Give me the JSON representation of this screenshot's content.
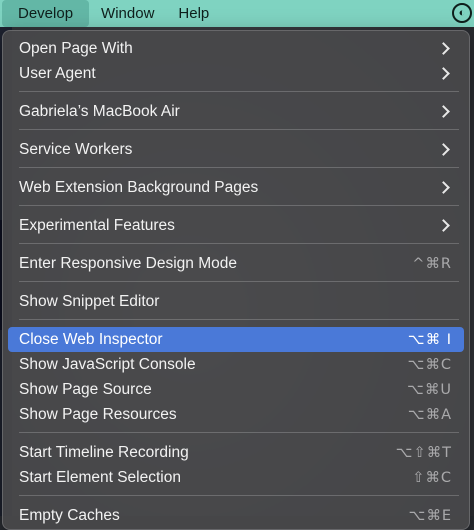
{
  "menubar": {
    "items": [
      {
        "label": "Develop",
        "active": true
      },
      {
        "label": "Window",
        "active": false
      },
      {
        "label": "Help",
        "active": false
      }
    ],
    "status_icon": "status-circle-icon"
  },
  "menu": {
    "items": [
      {
        "label": "Open Page With",
        "submenu": true
      },
      {
        "label": "User Agent",
        "submenu": true
      },
      {
        "label": "Gabriela’s MacBook Air",
        "submenu": true
      },
      {
        "label": "Service Workers",
        "submenu": true
      },
      {
        "label": "Web Extension Background Pages",
        "submenu": true
      },
      {
        "label": "Experimental Features",
        "submenu": true
      },
      {
        "label": "Enter Responsive Design Mode",
        "shortcut": "^⌘R"
      },
      {
        "label": "Show Snippet Editor"
      },
      {
        "label": "Close Web Inspector",
        "shortcut": "⌥⌘ I",
        "highlighted": true
      },
      {
        "label": "Show JavaScript Console",
        "shortcut": "⌥⌘C"
      },
      {
        "label": "Show Page Source",
        "shortcut": "⌥⌘U"
      },
      {
        "label": "Show Page Resources",
        "shortcut": "⌥⌘A"
      },
      {
        "label": "Start Timeline Recording",
        "shortcut": "⌥⇧⌘T"
      },
      {
        "label": "Start Element Selection",
        "shortcut": "⇧⌘C"
      },
      {
        "label": "Empty Caches",
        "shortcut": "⌥⌘E"
      }
    ]
  },
  "colors": {
    "menubar_bg": "#7fd3c1",
    "highlight": "#4a79d8"
  }
}
